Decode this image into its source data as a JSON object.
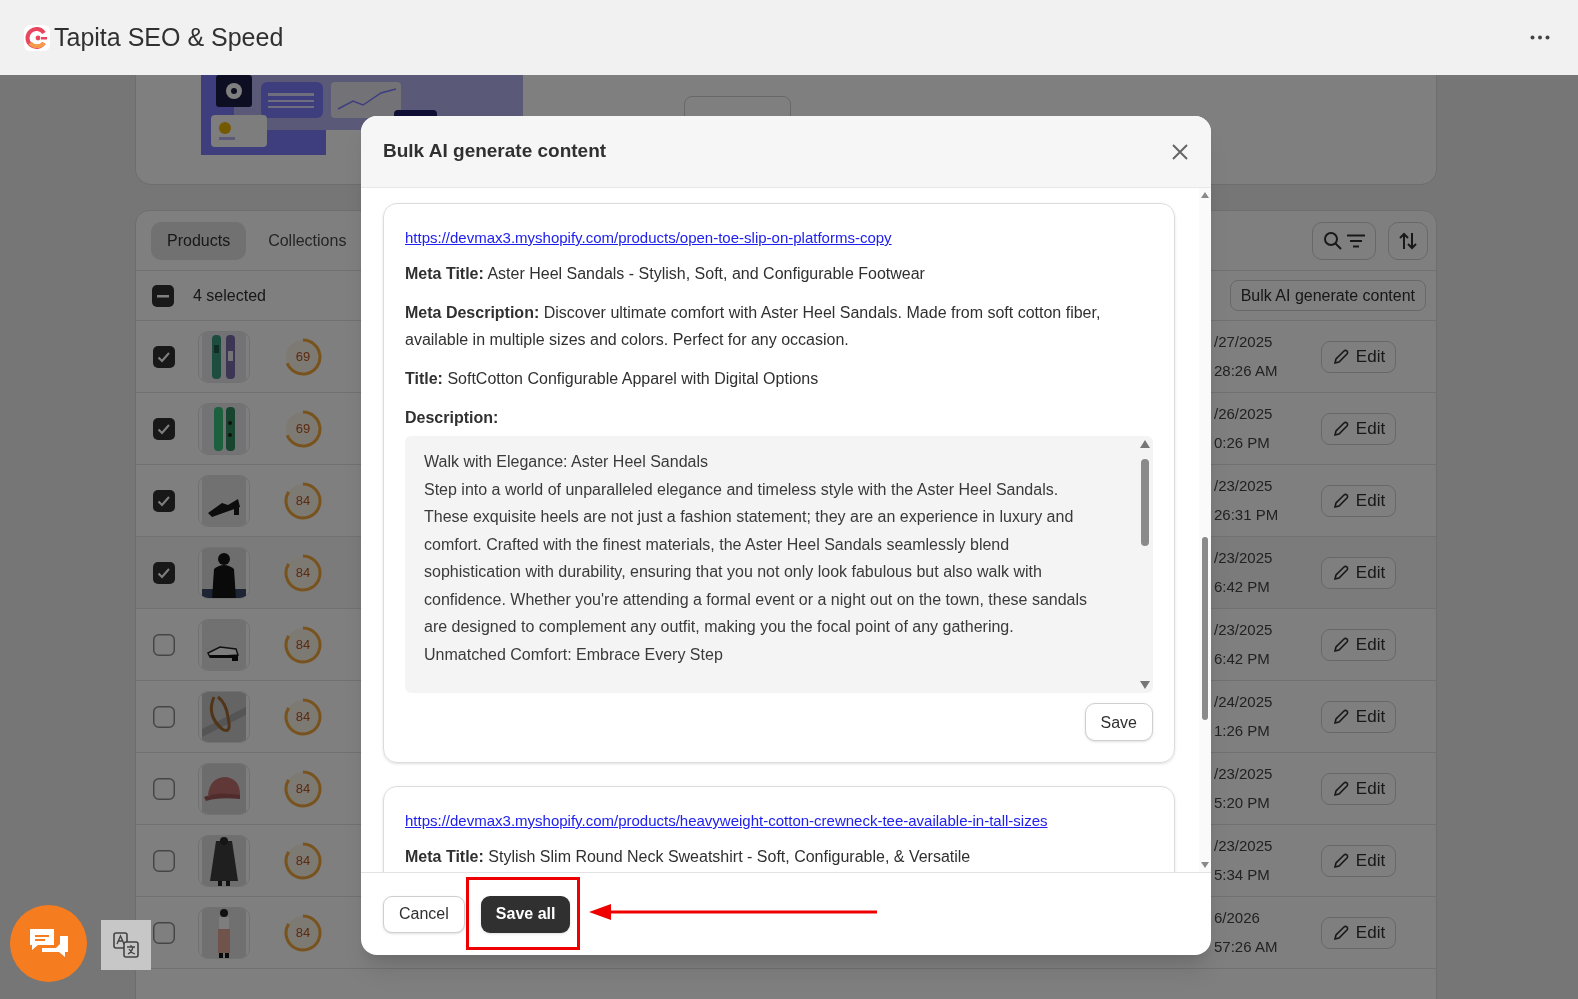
{
  "app": {
    "title": "Tapita SEO & Speed"
  },
  "tabs": [
    {
      "label": "Products",
      "selected": true
    },
    {
      "label": "Collections",
      "selected": false
    }
  ],
  "selection": {
    "indeterminate": true,
    "count": "4 selected",
    "bulk_button": "Bulk AI generate content"
  },
  "rows": [
    {
      "checked": true,
      "score": "69",
      "date": "/27/2025",
      "time": "28:26 AM",
      "edit": "Edit"
    },
    {
      "checked": true,
      "score": "69",
      "date": "/26/2025",
      "time": "0:26 PM",
      "edit": "Edit"
    },
    {
      "checked": true,
      "score": "84",
      "date": "/23/2025",
      "time": "26:31 PM",
      "edit": "Edit"
    },
    {
      "checked": true,
      "score": "84",
      "date": "/23/2025",
      "time": "6:42 PM",
      "edit": "Edit"
    },
    {
      "checked": false,
      "score": "84",
      "date": "/23/2025",
      "time": "6:42 PM",
      "edit": "Edit"
    },
    {
      "checked": false,
      "score": "84",
      "date": "/24/2025",
      "time": "1:26 PM",
      "edit": "Edit"
    },
    {
      "checked": false,
      "score": "84",
      "date": "/23/2025",
      "time": "5:20 PM",
      "edit": "Edit"
    },
    {
      "checked": false,
      "score": "84",
      "date": "/23/2025",
      "time": "5:34 PM",
      "edit": "Edit"
    },
    {
      "checked": false,
      "score": "84",
      "date": "6/2026",
      "time": "57:26 AM",
      "edit": "Edit"
    }
  ],
  "modal": {
    "title": "Bulk AI generate content",
    "items": [
      {
        "url": "https://devmax3.myshopify.com/products/open-toe-slip-on-platforms-copy",
        "meta_title": "**Meta Title:** Aster Heel Sandals - Stylish, Soft, and Configurable Footwear",
        "meta_description": "**Meta Description:** Discover ultimate comfort with Aster Heel Sandals. Made from soft cotton fiber, available in multiple sizes and colors. Perfect for any occasion.",
        "title": "**Title:** SoftCotton Configurable Apparel with Digital Options",
        "description_label": "Description:",
        "description": [
          "Walk with Elegance: Aster Heel Sandals",
          "Step into a world of unparalleled elegance and timeless style with the Aster Heel Sandals. These exquisite heels are not just a fashion statement; they are an experience in luxury and comfort. Crafted with the finest materials, the Aster Heel Sandals seamlessly blend sophistication with durability, ensuring that you not only look fabulous but also walk with confidence. Whether you're attending a formal event or a night out on the town, these sandals are designed to complement any outfit, making you the focal point of any gathering.",
          "Unmatched Comfort: Embrace Every Step"
        ],
        "save": "Save"
      },
      {
        "url": "https://devmax3.myshopify.com/products/heavyweight-cotton-crewneck-tee-available-in-tall-sizes",
        "meta_title": "**Meta Title:** Stylish Slim Round Neck Sweatshirt - Soft, Configurable, & Versatile"
      }
    ],
    "cancel": "Cancel",
    "save_all": "Save all"
  }
}
